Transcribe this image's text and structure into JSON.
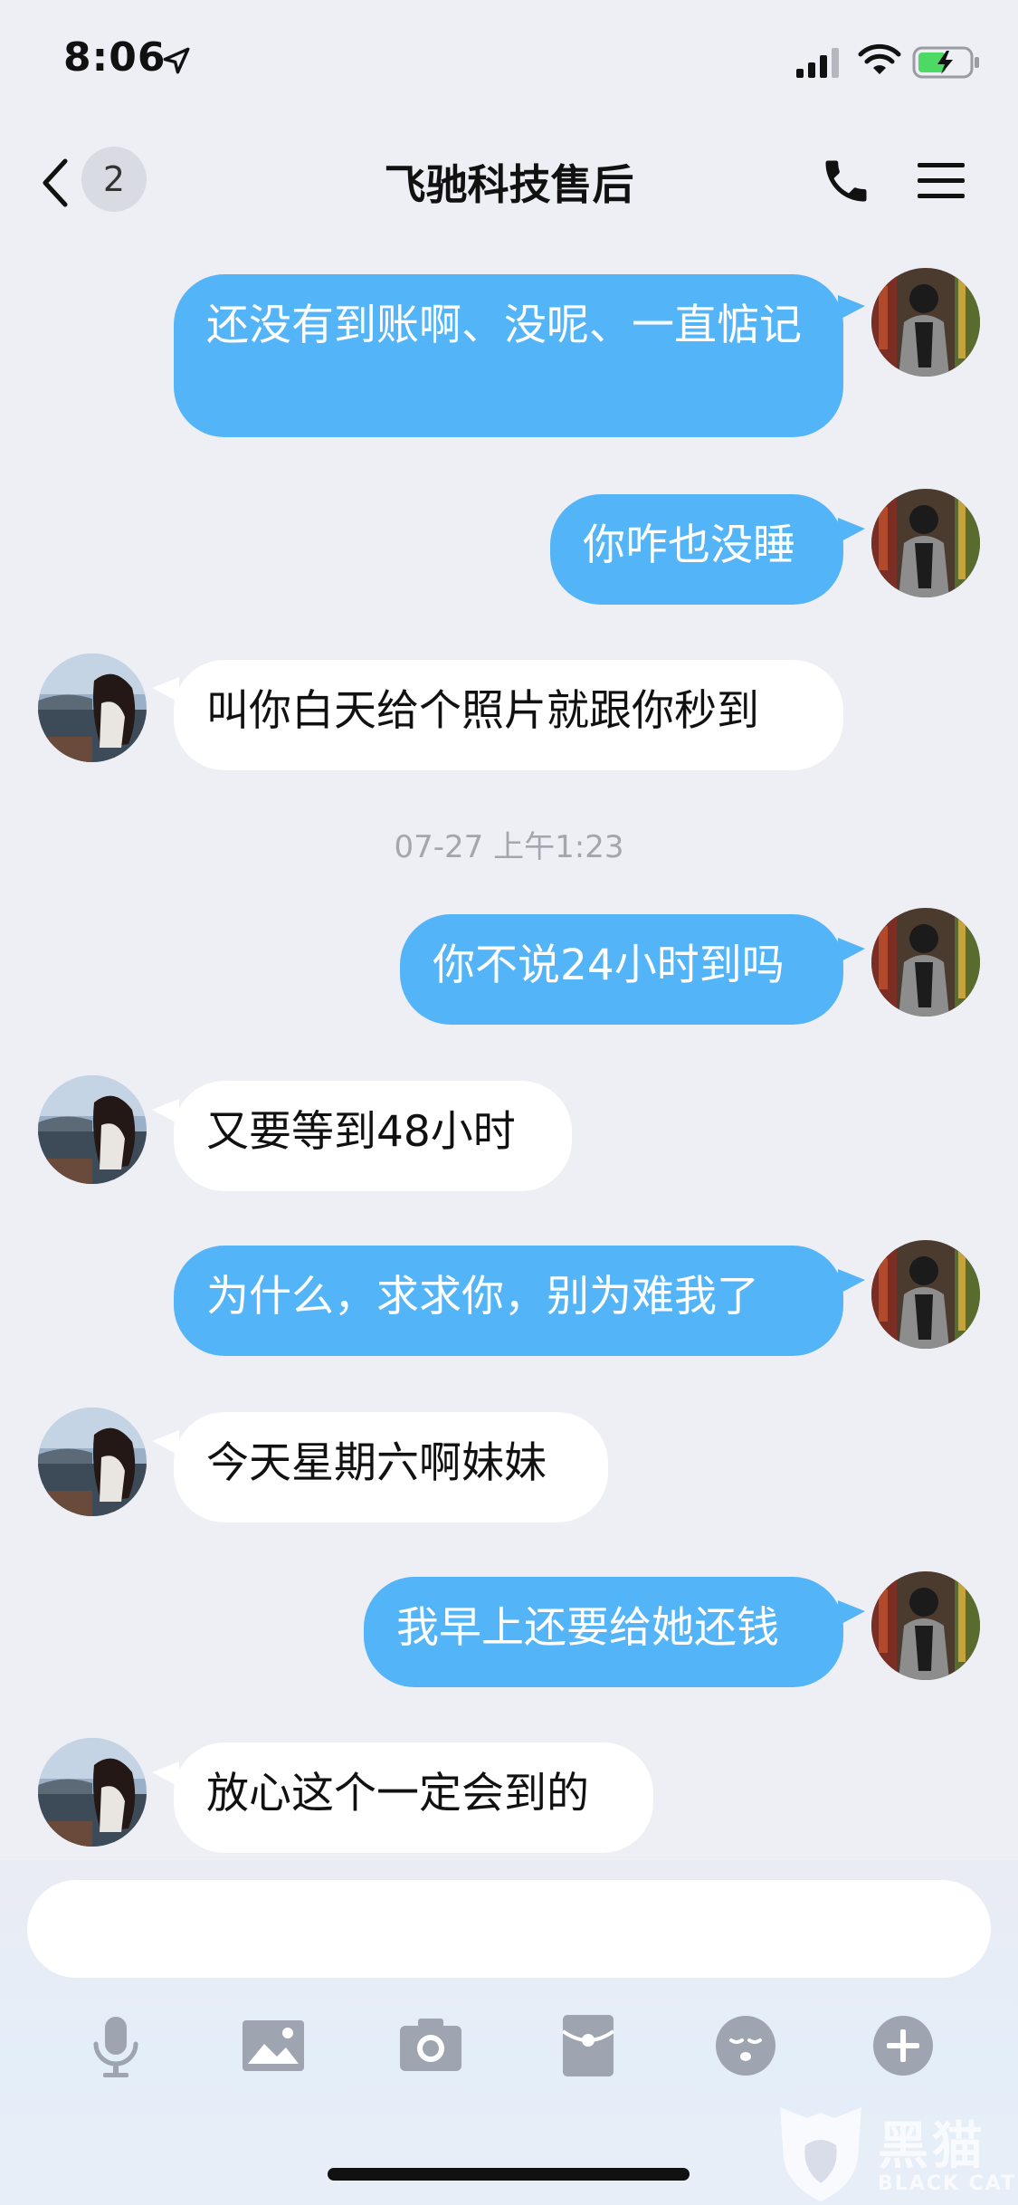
{
  "status_bar": {
    "time": "8:06"
  },
  "nav": {
    "unread_count": "2",
    "title": "飞驰科技售后"
  },
  "messages": [
    {
      "dir": "out",
      "text": "还没有到账啊、没呢、一直惦记"
    },
    {
      "dir": "out",
      "text": "你咋也没睡"
    },
    {
      "dir": "in",
      "text": "叫你白天给个照片就跟你秒到"
    },
    {
      "dir": "out",
      "text": "你不说24小时到吗"
    },
    {
      "dir": "in",
      "text": "又要等到48小时"
    },
    {
      "dir": "out",
      "text": "为什么，求求你，别为难我了"
    },
    {
      "dir": "in",
      "text": "今天星期六啊妹妹"
    },
    {
      "dir": "out",
      "text": "我早上还要给她还钱"
    },
    {
      "dir": "in",
      "text": "放心这个一定会到的"
    }
  ],
  "timestamp": "07-27 上午1:23",
  "input": {
    "value": "",
    "placeholder": ""
  },
  "toolbar": {
    "icons": [
      "microphone-icon",
      "image-icon",
      "camera-icon",
      "red-packet-icon",
      "emoji-icon",
      "plus-icon"
    ]
  },
  "colors": {
    "outgoing_bubble": "#54b4f8",
    "incoming_bubble": "#ffffff",
    "background": "#eeeef5"
  },
  "watermark": {
    "brand": "黑猫",
    "brand_en": "BLACK CAT"
  }
}
